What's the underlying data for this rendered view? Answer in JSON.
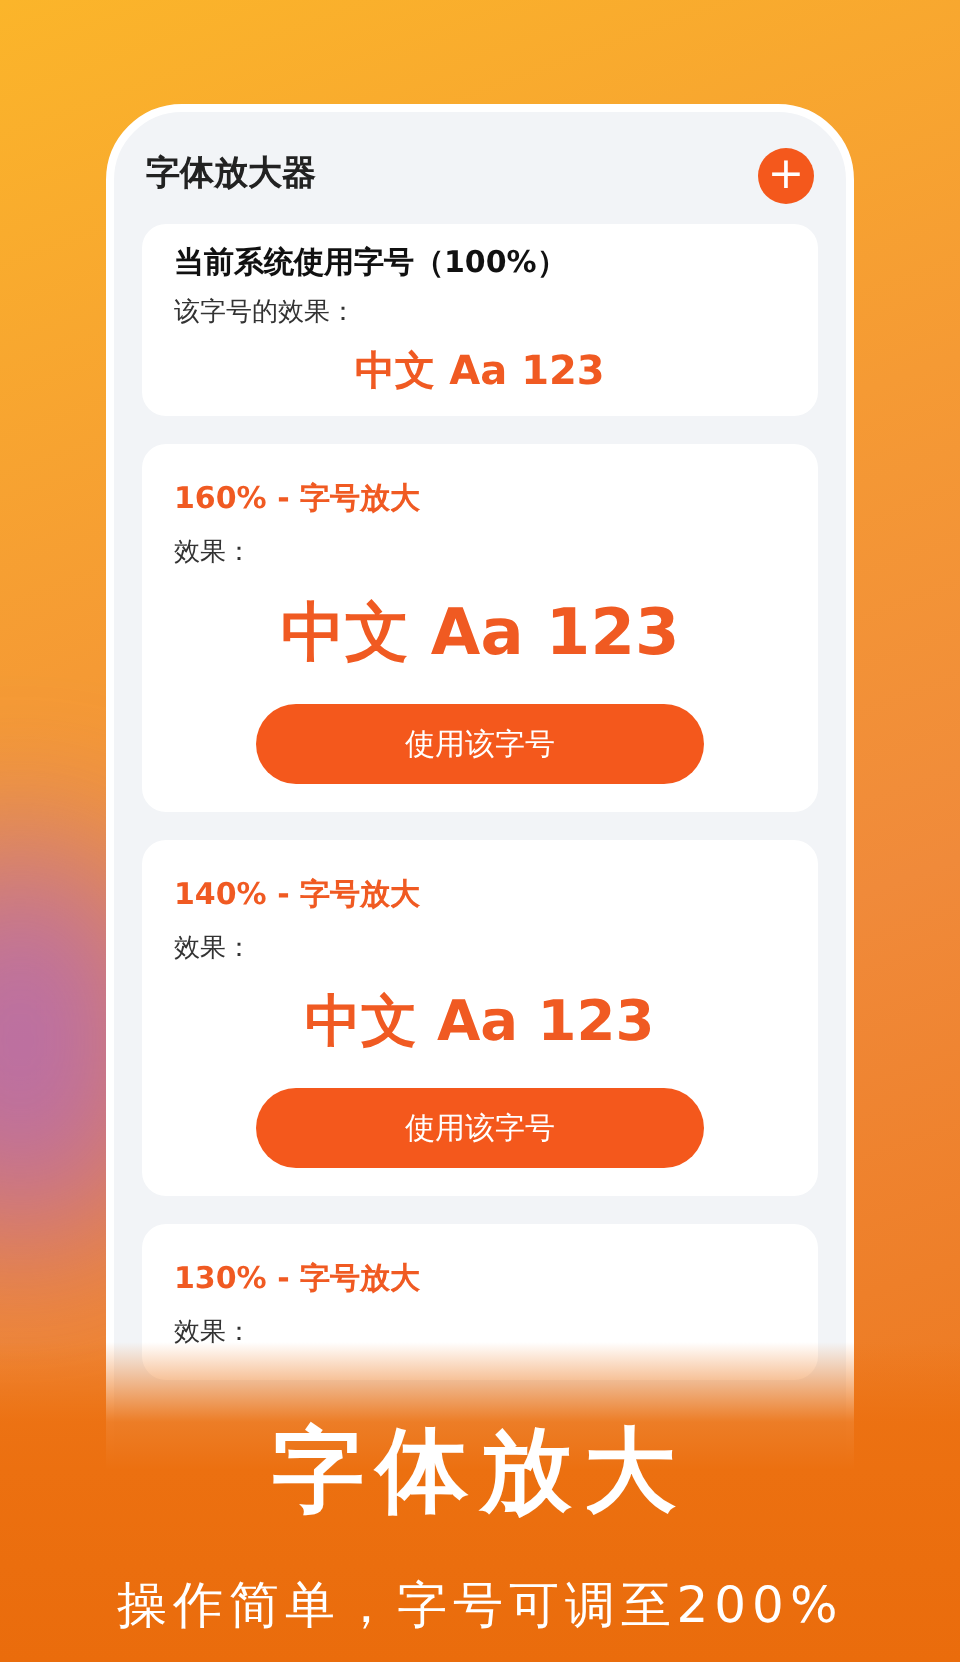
{
  "app": {
    "title": "字体放大器",
    "add_button": "+"
  },
  "current": {
    "title": "当前系统使用字号（100%）",
    "caption": "该字号的效果：",
    "sample": "中文 Aa 123"
  },
  "sizes": [
    {
      "title": "160% - 字号放大",
      "caption": "效果：",
      "sample": "中文 Aa 123",
      "button": "使用该字号"
    },
    {
      "title": "140% - 字号放大",
      "caption": "效果：",
      "sample": "中文 Aa 123",
      "button": "使用该字号"
    },
    {
      "title": "130% - 字号放大",
      "caption": "效果："
    }
  ],
  "promo": {
    "headline": "字体放大",
    "subline": "操作简单，字号可调至200%"
  }
}
